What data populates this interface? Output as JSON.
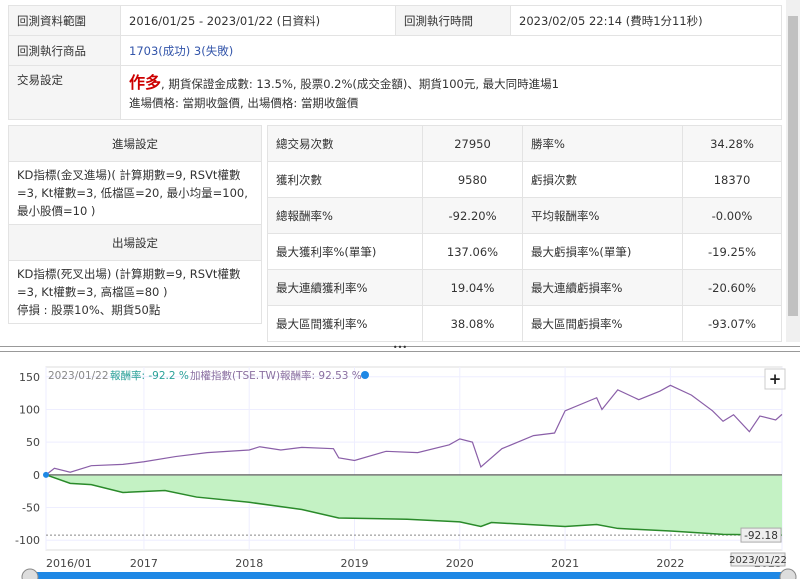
{
  "summary": {
    "range_label": "回測資料範圍",
    "range_value": "2016/01/25 - 2023/01/22 (日資料)",
    "time_label": "回測執行時間",
    "time_value": "2023/02/05 22:14 (費時1分11秒)",
    "product_label": "回測執行商品",
    "product_value": "1703(成功) 3(失敗)",
    "trade_label": "交易設定",
    "trade_direction": "作多",
    "trade_line1": ", 期貨保證金成數: 13.5%, 股票0.2%(成交金額)、期貨100元, 最大同時進場1",
    "trade_line2": "進場價格: 當期收盤價, 出場價格: 當期收盤價"
  },
  "settings": {
    "entry_header": "進場設定",
    "entry_text": "KD指標(金叉進場)( 計算期數=9, RSVt權數=3, Kt權數=3, 低檔區=20, 最小均量=100, 最小股價=10 )",
    "exit_header": "出場設定",
    "exit_text": "KD指標(死叉出場) (計算期數=9, RSVt權數=3, Kt權數=3, 高檔區=80 )",
    "stop_text": "停損 : 股票10%、期貨50點"
  },
  "stats": [
    [
      "總交易次數",
      "27950",
      "勝率%",
      "34.28%"
    ],
    [
      "獲利次數",
      "9580",
      "虧損次數",
      "18370"
    ],
    [
      "總報酬率%",
      "-92.20%",
      "平均報酬率%",
      "-0.00%"
    ],
    [
      "最大獲利率%(單筆)",
      "137.06%",
      "最大虧損率%(單筆)",
      "-19.25%"
    ],
    [
      "最大連續獲利率%",
      "19.04%",
      "最大連續虧損率%",
      "-20.60%"
    ],
    [
      "最大區間獲利率%",
      "38.08%",
      "最大區間虧損率%",
      "-93.07%"
    ]
  ],
  "divider_label": "•••",
  "chart_data": {
    "type": "line",
    "legend": {
      "date": "2023/01/22",
      "strategy_label": "報酬率: -92.2 %",
      "index_label": "加權指數(TSE.TW)報酬率: 92.53 %"
    },
    "zoom_button": "+",
    "ylim": [
      -115,
      165
    ],
    "yticks": [
      150,
      100,
      50,
      0,
      -50,
      -100
    ],
    "xlim": [
      2016.07,
      2023.06
    ],
    "xticks": [
      {
        "v": 2016.07,
        "label": "2016/01"
      },
      {
        "v": 2017,
        "label": "2017"
      },
      {
        "v": 2018,
        "label": "2018"
      },
      {
        "v": 2019,
        "label": "2019"
      },
      {
        "v": 2020,
        "label": "2020"
      },
      {
        "v": 2021,
        "label": "2021"
      },
      {
        "v": 2022,
        "label": "2022"
      },
      {
        "v": 2023.06,
        "label": "2023"
      }
    ],
    "last_value_label": "-92.18",
    "last_date_label": "2023/01/22",
    "colors": {
      "index": "#8a5fa8",
      "strategy": "#2a8a2a",
      "fill": "#c4f2c4",
      "strategy_legend": "#2aa198",
      "accent": "#1e88e5"
    },
    "series": [
      {
        "name": "加權指數(TSE.TW)",
        "x": [
          2016.07,
          2016.15,
          2016.3,
          2016.5,
          2016.8,
          2017.0,
          2017.3,
          2017.6,
          2018.0,
          2018.1,
          2018.3,
          2018.5,
          2018.8,
          2018.85,
          2019.0,
          2019.3,
          2019.6,
          2019.9,
          2020.0,
          2020.12,
          2020.2,
          2020.4,
          2020.7,
          2020.9,
          2021.0,
          2021.3,
          2021.35,
          2021.5,
          2021.7,
          2021.9,
          2022.0,
          2022.2,
          2022.4,
          2022.5,
          2022.6,
          2022.75,
          2022.85,
          2023.0,
          2023.06
        ],
        "y": [
          0,
          10,
          4,
          14,
          16,
          20,
          28,
          34,
          38,
          43,
          38,
          42,
          40,
          26,
          22,
          36,
          34,
          46,
          55,
          50,
          12,
          40,
          60,
          64,
          98,
          118,
          100,
          130,
          115,
          128,
          137,
          122,
          98,
          82,
          92,
          66,
          90,
          84,
          92.53
        ]
      },
      {
        "name": "報酬率",
        "x": [
          2016.07,
          2016.3,
          2016.5,
          2016.8,
          2017.2,
          2017.5,
          2018.0,
          2018.5,
          2018.85,
          2019.5,
          2020.0,
          2020.2,
          2020.3,
          2021.0,
          2021.3,
          2021.5,
          2022.0,
          2022.5,
          2023.06
        ],
        "y": [
          0,
          -13,
          -15,
          -27,
          -24,
          -34,
          -42,
          -53,
          -66,
          -68,
          -72,
          -79,
          -73,
          -79,
          -76,
          -82,
          -86,
          -91,
          -92.18
        ]
      }
    ]
  }
}
